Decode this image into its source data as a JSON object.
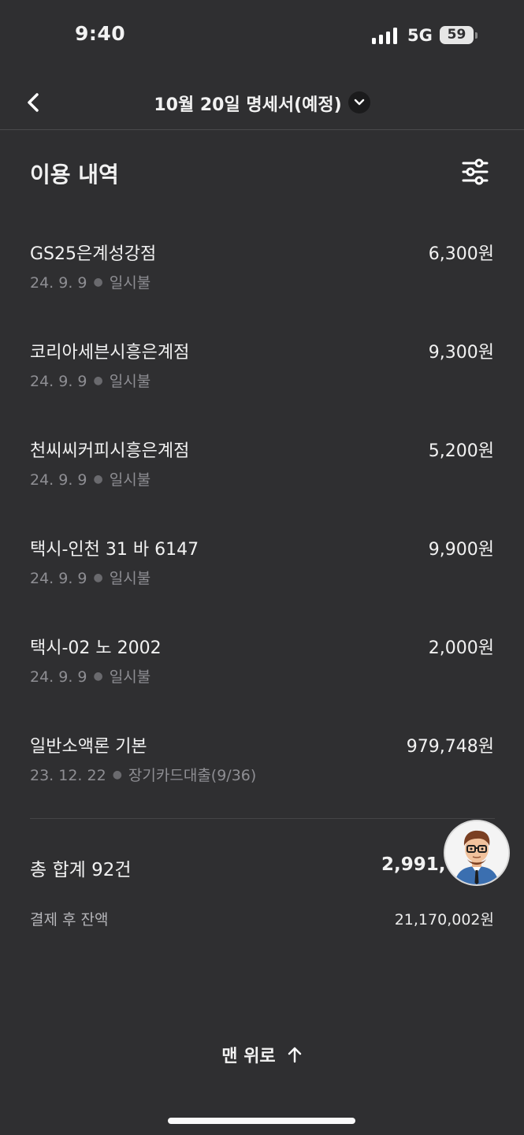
{
  "status_bar": {
    "time": "9:40",
    "network": "5G",
    "battery": "59",
    "signal_icon": "cellular-signal-icon"
  },
  "header": {
    "back_icon": "chevron-left-icon",
    "title": "10월 20일 명세서(예정)",
    "dropdown_icon": "chevron-down-icon"
  },
  "section": {
    "title": "이용 내역",
    "filter_icon": "sliders-icon"
  },
  "transactions": [
    {
      "merchant": "GS25은계성강점",
      "amount": "6,300원",
      "date": "24. 9. 9",
      "type": "일시불"
    },
    {
      "merchant": "코리아세븐시흥은계점",
      "amount": "9,300원",
      "date": "24. 9. 9",
      "type": "일시불"
    },
    {
      "merchant": "천씨씨커피시흥은계점",
      "amount": "5,200원",
      "date": "24. 9. 9",
      "type": "일시불"
    },
    {
      "merchant": "택시-인천 31 바 6147",
      "amount": "9,900원",
      "date": "24. 9. 9",
      "type": "일시불"
    },
    {
      "merchant": "택시-02 노 2002",
      "amount": "2,000원",
      "date": "24. 9. 9",
      "type": "일시불"
    },
    {
      "merchant": "일반소액론 기본",
      "amount": "979,748원",
      "date": "23. 12. 22",
      "type": "장기카드대출(9/36)"
    }
  ],
  "summary": {
    "total_label": "총 합계 92건",
    "total_amount": "2,991,6",
    "balance_label": "결제 후 잔액",
    "balance_amount": "21,170,002원"
  },
  "avatar": {
    "icon": "assistant-avatar-icon"
  },
  "footer": {
    "scroll_top_label": "맨 위로",
    "scroll_top_icon": "arrow-up-icon"
  }
}
